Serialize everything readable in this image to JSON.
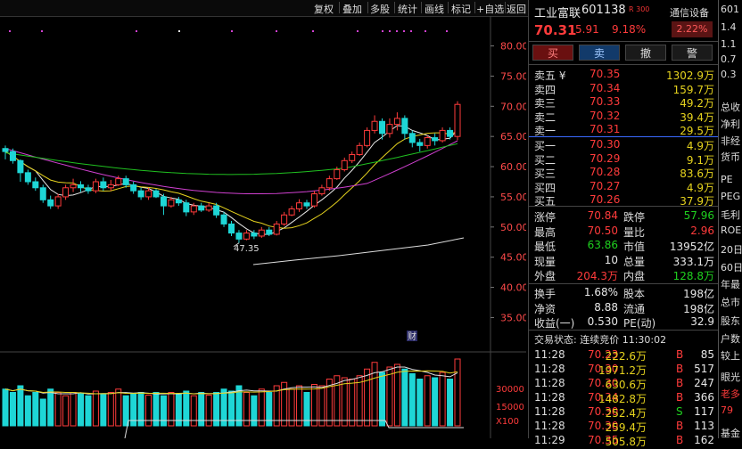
{
  "toolbar": {
    "buttons": [
      "复权",
      "叠加",
      "多股",
      "统计",
      "画线",
      "标记",
      "+自选",
      "返回"
    ]
  },
  "chart": {
    "y_axis_labels": [
      "80.00",
      "75.00",
      "70.00",
      "65.00",
      "60.00",
      "55.00",
      "50.00",
      "45.00",
      "40.00",
      "35.00"
    ],
    "low_marker": "47.35",
    "fin_marker": "财",
    "volume_labels": [
      "30000",
      "15000",
      "X100"
    ]
  },
  "chart_data": {
    "type": "candlestick",
    "y_range": [
      33,
      82
    ],
    "candles": [
      [
        63,
        62.5,
        61.2,
        63.5
      ],
      [
        62.5,
        61,
        60.5,
        63
      ],
      [
        61,
        59,
        57.5,
        61.2
      ],
      [
        59,
        57.5,
        57,
        59.5
      ],
      [
        57.5,
        56.5,
        56,
        58.2
      ],
      [
        56.5,
        54.5,
        54,
        57
      ],
      [
        54.5,
        53.5,
        53,
        55.2
      ],
      [
        53.5,
        55,
        53,
        55.5
      ],
      [
        55,
        56.5,
        54.5,
        57
      ],
      [
        56.5,
        57,
        55.8,
        58
      ],
      [
        57,
        56.5,
        55.8,
        57.6
      ],
      [
        56.5,
        56,
        55.5,
        57
      ],
      [
        56,
        57.5,
        55.6,
        58
      ],
      [
        57.5,
        56.5,
        56,
        58.2
      ],
      [
        56.5,
        57,
        56,
        57.8
      ],
      [
        57,
        58,
        56.8,
        58.5
      ],
      [
        58,
        57,
        56.5,
        58.5
      ],
      [
        57,
        56,
        55.5,
        57.5
      ],
      [
        56,
        55,
        54.5,
        56.5
      ],
      [
        55,
        56,
        54.5,
        56.5
      ],
      [
        56,
        55,
        54.8,
        56.3
      ],
      [
        55,
        53.5,
        52,
        55.5
      ],
      [
        53.5,
        54.5,
        53.2,
        55
      ],
      [
        54.5,
        54,
        53.5,
        55
      ],
      [
        54,
        52.5,
        51.8,
        54.5
      ],
      [
        52.5,
        53.5,
        52,
        54
      ],
      [
        53.5,
        52.8,
        52.5,
        54
      ],
      [
        52.8,
        53.5,
        52.5,
        54
      ],
      [
        53.5,
        52,
        51.5,
        54
      ],
      [
        52,
        50.5,
        50,
        52.5
      ],
      [
        50.5,
        49,
        48.5,
        51
      ],
      [
        49,
        48,
        47.35,
        49.5
      ],
      [
        48,
        49,
        47.8,
        49.5
      ],
      [
        49,
        48.5,
        48,
        49.5
      ],
      [
        48.5,
        49.5,
        48.2,
        50
      ],
      [
        49.5,
        48.8,
        48.5,
        50
      ],
      [
        48.8,
        50.5,
        48.6,
        51
      ],
      [
        50.5,
        52,
        50.2,
        52.5
      ],
      [
        52,
        53,
        51.8,
        53.5
      ],
      [
        53,
        54,
        52.5,
        54.6
      ],
      [
        54,
        53.5,
        53,
        54.5
      ],
      [
        53.5,
        55.5,
        53.2,
        56
      ],
      [
        55.5,
        56.5,
        55.2,
        57
      ],
      [
        56.5,
        58,
        56,
        58.5
      ],
      [
        58,
        59.5,
        57.8,
        60
      ],
      [
        59.5,
        61,
        59.2,
        61.5
      ],
      [
        61,
        62,
        60.6,
        62.5
      ],
      [
        62,
        63.5,
        61.8,
        64
      ],
      [
        63.5,
        66,
        63.2,
        66.5
      ],
      [
        66,
        67.5,
        65.5,
        68.5
      ],
      [
        67.5,
        65.5,
        64.5,
        68
      ],
      [
        65.5,
        67,
        64.8,
        68
      ],
      [
        67,
        68,
        66,
        69
      ],
      [
        68,
        65.5,
        64.5,
        68.5
      ],
      [
        65.5,
        64,
        63.2,
        66
      ],
      [
        64,
        63.5,
        62.5,
        64.6
      ],
      [
        63.5,
        64.8,
        63,
        65.2
      ],
      [
        64.8,
        64.3,
        63.5,
        65.5
      ],
      [
        64.3,
        66,
        64,
        66.5
      ],
      [
        66,
        65,
        64.5,
        66.5
      ],
      [
        65,
        70.31,
        64.39,
        70.84
      ]
    ],
    "volumes": [
      0.55,
      0.5,
      0.6,
      0.45,
      0.5,
      0.4,
      0.55,
      0.5,
      0.45,
      0.5,
      0.48,
      0.45,
      0.52,
      0.47,
      0.5,
      0.55,
      0.45,
      0.48,
      0.5,
      0.46,
      0.5,
      0.45,
      0.5,
      0.48,
      0.52,
      0.45,
      0.5,
      0.46,
      0.5,
      0.55,
      0.52,
      0.6,
      0.5,
      0.45,
      0.55,
      0.5,
      0.6,
      0.65,
      0.55,
      0.6,
      0.5,
      0.62,
      0.6,
      0.7,
      0.75,
      0.72,
      0.7,
      0.75,
      0.85,
      0.95,
      0.8,
      0.88,
      0.92,
      0.85,
      0.78,
      0.7,
      0.75,
      0.72,
      0.8,
      0.7,
      1.0
    ]
  },
  "quote": {
    "name": "工业富联",
    "code": "601138",
    "tag": "R 300",
    "price": "70.31",
    "change": "5.91",
    "pct": "9.18%",
    "tong_label": "通信设备",
    "tong_pct": "2.22%",
    "actions": [
      "买",
      "卖",
      "撤",
      "警"
    ],
    "asks": [
      {
        "label": "卖五 ¥",
        "price": "70.35",
        "vol": "1302.9万"
      },
      {
        "label": "卖四",
        "price": "70.34",
        "vol": "159.7万"
      },
      {
        "label": "卖三",
        "price": "70.33",
        "vol": "49.2万"
      },
      {
        "label": "卖二",
        "price": "70.32",
        "vol": "39.4万"
      },
      {
        "label": "卖一",
        "price": "70.31",
        "vol": "29.5万"
      }
    ],
    "bids": [
      {
        "label": "买一",
        "price": "70.30",
        "vol": "4.9万"
      },
      {
        "label": "买二",
        "price": "70.29",
        "vol": "9.1万"
      },
      {
        "label": "买三",
        "price": "70.28",
        "vol": "83.6万"
      },
      {
        "label": "买四",
        "price": "70.27",
        "vol": "4.9万"
      },
      {
        "label": "买五",
        "price": "70.26",
        "vol": "37.9万"
      }
    ],
    "stats": [
      {
        "l1": "涨停",
        "v1": "70.84",
        "c1": "red",
        "l2": "跌停",
        "v2": "57.96",
        "c2": "grn"
      },
      {
        "l1": "最高",
        "v1": "70.50",
        "c1": "red",
        "l2": "量比",
        "v2": "2.96",
        "c2": "red"
      },
      {
        "l1": "最低",
        "v1": "63.86",
        "c1": "grn",
        "l2": "市值",
        "v2": "13952亿",
        "c2": "wht"
      },
      {
        "l1": "现量",
        "v1": "10",
        "c1": "wht",
        "l2": "总量",
        "v2": "333.1万",
        "c2": "wht"
      },
      {
        "l1": "外盘",
        "v1": "204.3万",
        "c1": "red",
        "l2": "内盘",
        "v2": "128.8万",
        "c2": "grn"
      }
    ],
    "stats2": [
      {
        "l1": "换手",
        "v1": "1.68%",
        "l2": "股本",
        "v2": "198亿"
      },
      {
        "l1": "净资",
        "v1": "8.88",
        "l2": "流通",
        "v2": "198亿"
      },
      {
        "l1": "收益(一)",
        "v1": "0.530",
        "l2": "PE(动)",
        "v2": "32.9"
      }
    ],
    "trade_status": "交易状态: 连续竞价 11:30:02",
    "ticks": [
      {
        "time": "11:28",
        "price": "70.23",
        "vol": "222.6万",
        "dir": "B",
        "n": "85"
      },
      {
        "time": "11:28",
        "price": "70.30",
        "vol": "1971.2万",
        "dir": "B",
        "n": "517"
      },
      {
        "time": "11:28",
        "price": "70.30",
        "vol": "630.6万",
        "dir": "B",
        "n": "247"
      },
      {
        "time": "11:28",
        "price": "70.34",
        "vol": "1482.8万",
        "dir": "B",
        "n": "366"
      },
      {
        "time": "11:28",
        "price": "70.30",
        "vol": "252.4万",
        "dir": "S",
        "n": "117"
      },
      {
        "time": "11:28",
        "price": "70.30",
        "vol": "259.4万",
        "dir": "B",
        "n": "113"
      },
      {
        "time": "11:29",
        "price": "70.35",
        "vol": "505.8万",
        "dir": "B",
        "n": "162"
      }
    ]
  },
  "farright": {
    "lines": [
      "601",
      "1.4",
      "1.1",
      "0.7",
      "0.3",
      "总收",
      "净利",
      "非经",
      "货币",
      "PE",
      "PEG",
      "毛利",
      "ROE",
      "20日",
      "60日",
      "年最",
      "总市",
      "股东",
      "户数",
      "较上",
      "眼光",
      "老多",
      "79",
      "基金"
    ]
  },
  "colors": {
    "up": "#ff3b3b",
    "down": "#1ed6d6",
    "ma5": "#e8e8e8",
    "ma10": "#e6d31e",
    "ma20": "#d040d0",
    "ma60": "#20c020"
  }
}
